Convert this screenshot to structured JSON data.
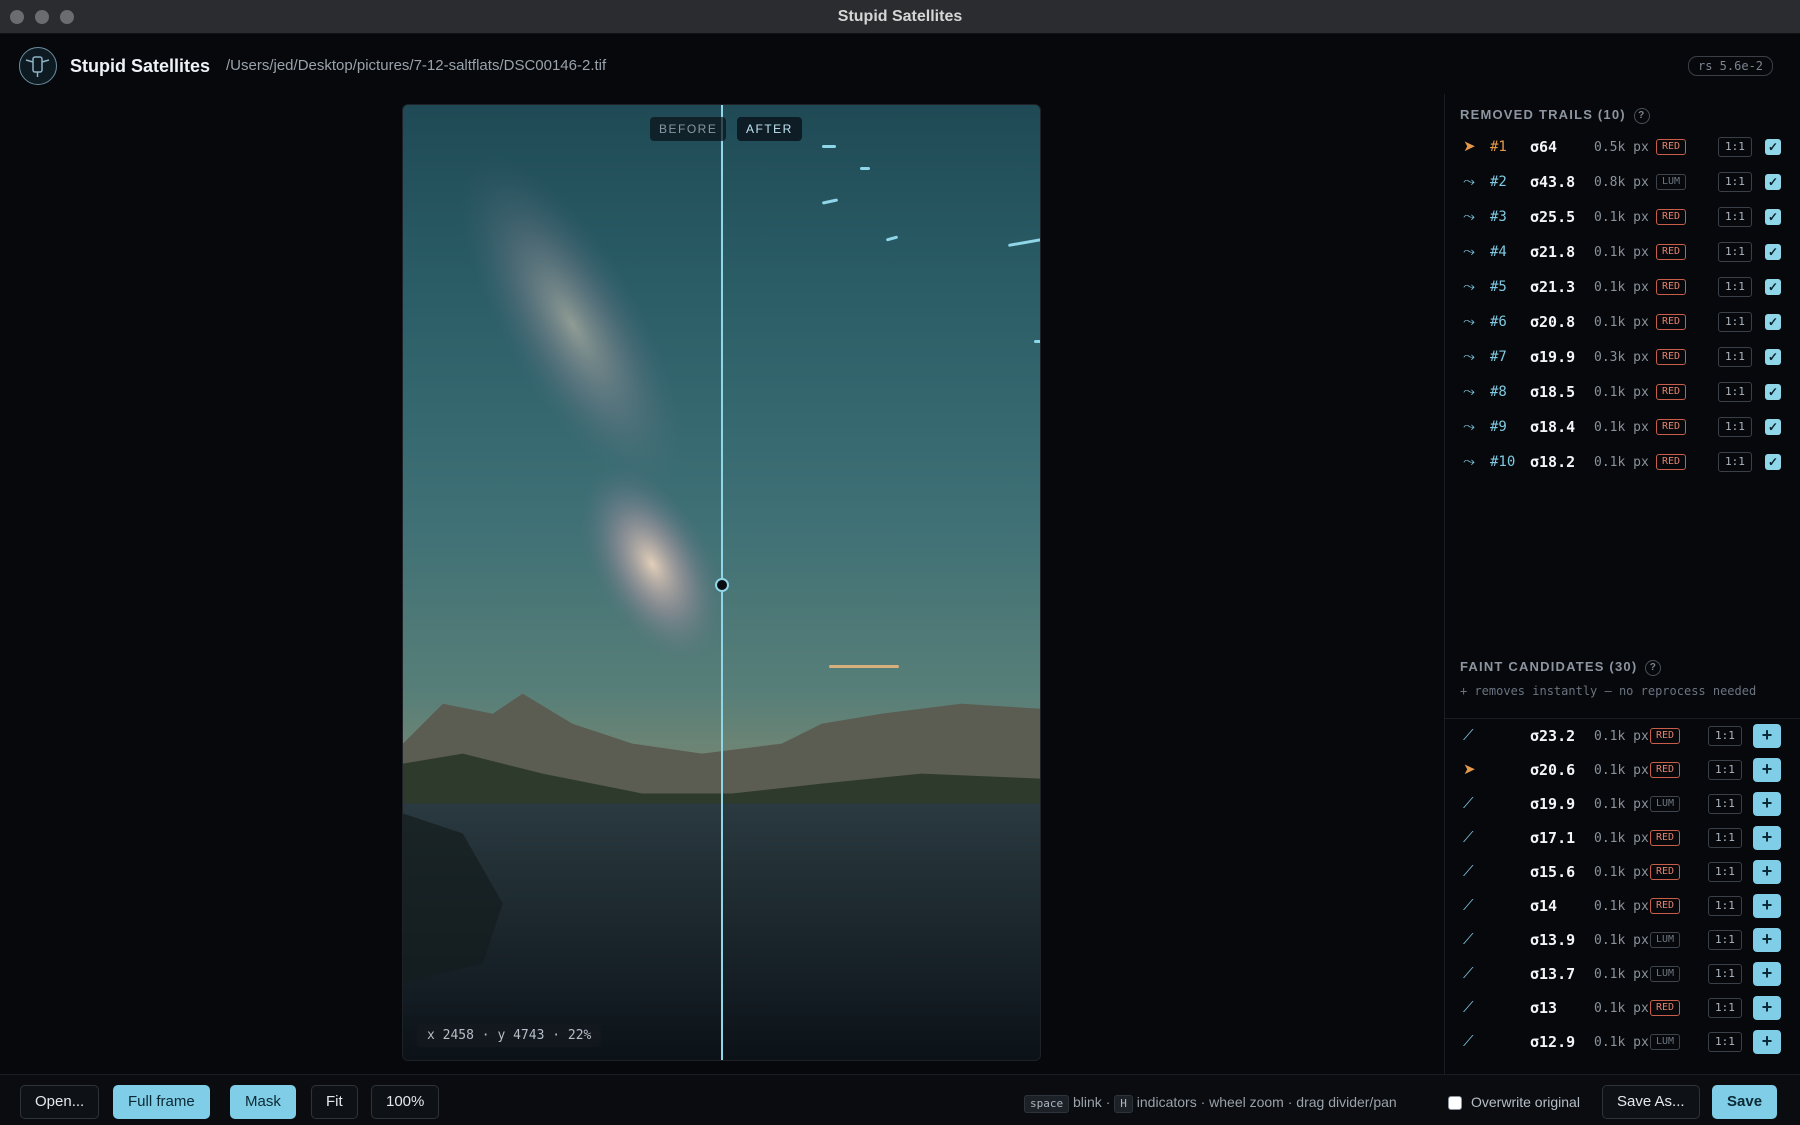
{
  "window": {
    "title": "Stupid Satellites"
  },
  "header": {
    "app_name": "Stupid Satellites",
    "file_path": "/Users/jed/Desktop/pictures/7-12-saltflats/DSC00146-2.tif",
    "version": "rs 5.6e-2"
  },
  "viewer": {
    "before_label": "BEFORE",
    "after_label": "AFTER",
    "coords": "x 2458 · y 4743 · 22%"
  },
  "removed": {
    "title": "REMOVED TRAILS (10)",
    "help": "?",
    "rows": [
      {
        "num": "#1",
        "sigma": "σ64",
        "px": "0.5k px",
        "tag": "RED",
        "ratio": "1:1"
      },
      {
        "num": "#2",
        "sigma": "σ43.8",
        "px": "0.8k px",
        "tag": "LUM",
        "ratio": "1:1"
      },
      {
        "num": "#3",
        "sigma": "σ25.5",
        "px": "0.1k px",
        "tag": "RED",
        "ratio": "1:1"
      },
      {
        "num": "#4",
        "sigma": "σ21.8",
        "px": "0.1k px",
        "tag": "RED",
        "ratio": "1:1"
      },
      {
        "num": "#5",
        "sigma": "σ21.3",
        "px": "0.1k px",
        "tag": "RED",
        "ratio": "1:1"
      },
      {
        "num": "#6",
        "sigma": "σ20.8",
        "px": "0.1k px",
        "tag": "RED",
        "ratio": "1:1"
      },
      {
        "num": "#7",
        "sigma": "σ19.9",
        "px": "0.3k px",
        "tag": "RED",
        "ratio": "1:1"
      },
      {
        "num": "#8",
        "sigma": "σ18.5",
        "px": "0.1k px",
        "tag": "RED",
        "ratio": "1:1"
      },
      {
        "num": "#9",
        "sigma": "σ18.4",
        "px": "0.1k px",
        "tag": "RED",
        "ratio": "1:1"
      },
      {
        "num": "#10",
        "sigma": "σ18.2",
        "px": "0.1k px",
        "tag": "RED",
        "ratio": "1:1"
      }
    ]
  },
  "faint": {
    "title": "FAINT CANDIDATES (30)",
    "help": "?",
    "subtitle": "+ removes instantly — no reprocess needed",
    "rows": [
      {
        "sigma": "σ23.2",
        "px": "0.1k px",
        "tag": "RED",
        "ratio": "1:1"
      },
      {
        "sigma": "σ20.6",
        "px": "0.1k px",
        "tag": "RED",
        "ratio": "1:1"
      },
      {
        "sigma": "σ19.9",
        "px": "0.1k px",
        "tag": "LUM",
        "ratio": "1:1"
      },
      {
        "sigma": "σ17.1",
        "px": "0.1k px",
        "tag": "RED",
        "ratio": "1:1"
      },
      {
        "sigma": "σ15.6",
        "px": "0.1k px",
        "tag": "RED",
        "ratio": "1:1"
      },
      {
        "sigma": "σ14",
        "px": "0.1k px",
        "tag": "RED",
        "ratio": "1:1"
      },
      {
        "sigma": "σ13.9",
        "px": "0.1k px",
        "tag": "LUM",
        "ratio": "1:1"
      },
      {
        "sigma": "σ13.7",
        "px": "0.1k px",
        "tag": "LUM",
        "ratio": "1:1"
      },
      {
        "sigma": "σ13",
        "px": "0.1k px",
        "tag": "RED",
        "ratio": "1:1"
      },
      {
        "sigma": "σ12.9",
        "px": "0.1k px",
        "tag": "LUM",
        "ratio": "1:1"
      }
    ]
  },
  "toolbar": {
    "open": "Open...",
    "full_frame": "Full frame",
    "mask": "Mask",
    "fit": "Fit",
    "zoom": "100%",
    "hint_key1": "space",
    "hint_text1": "blink ·",
    "hint_key2": "H",
    "hint_text2": "indicators · wheel zoom · drag divider/pan",
    "overwrite": "Overwrite original",
    "save_as": "Save As...",
    "save": "Save"
  }
}
